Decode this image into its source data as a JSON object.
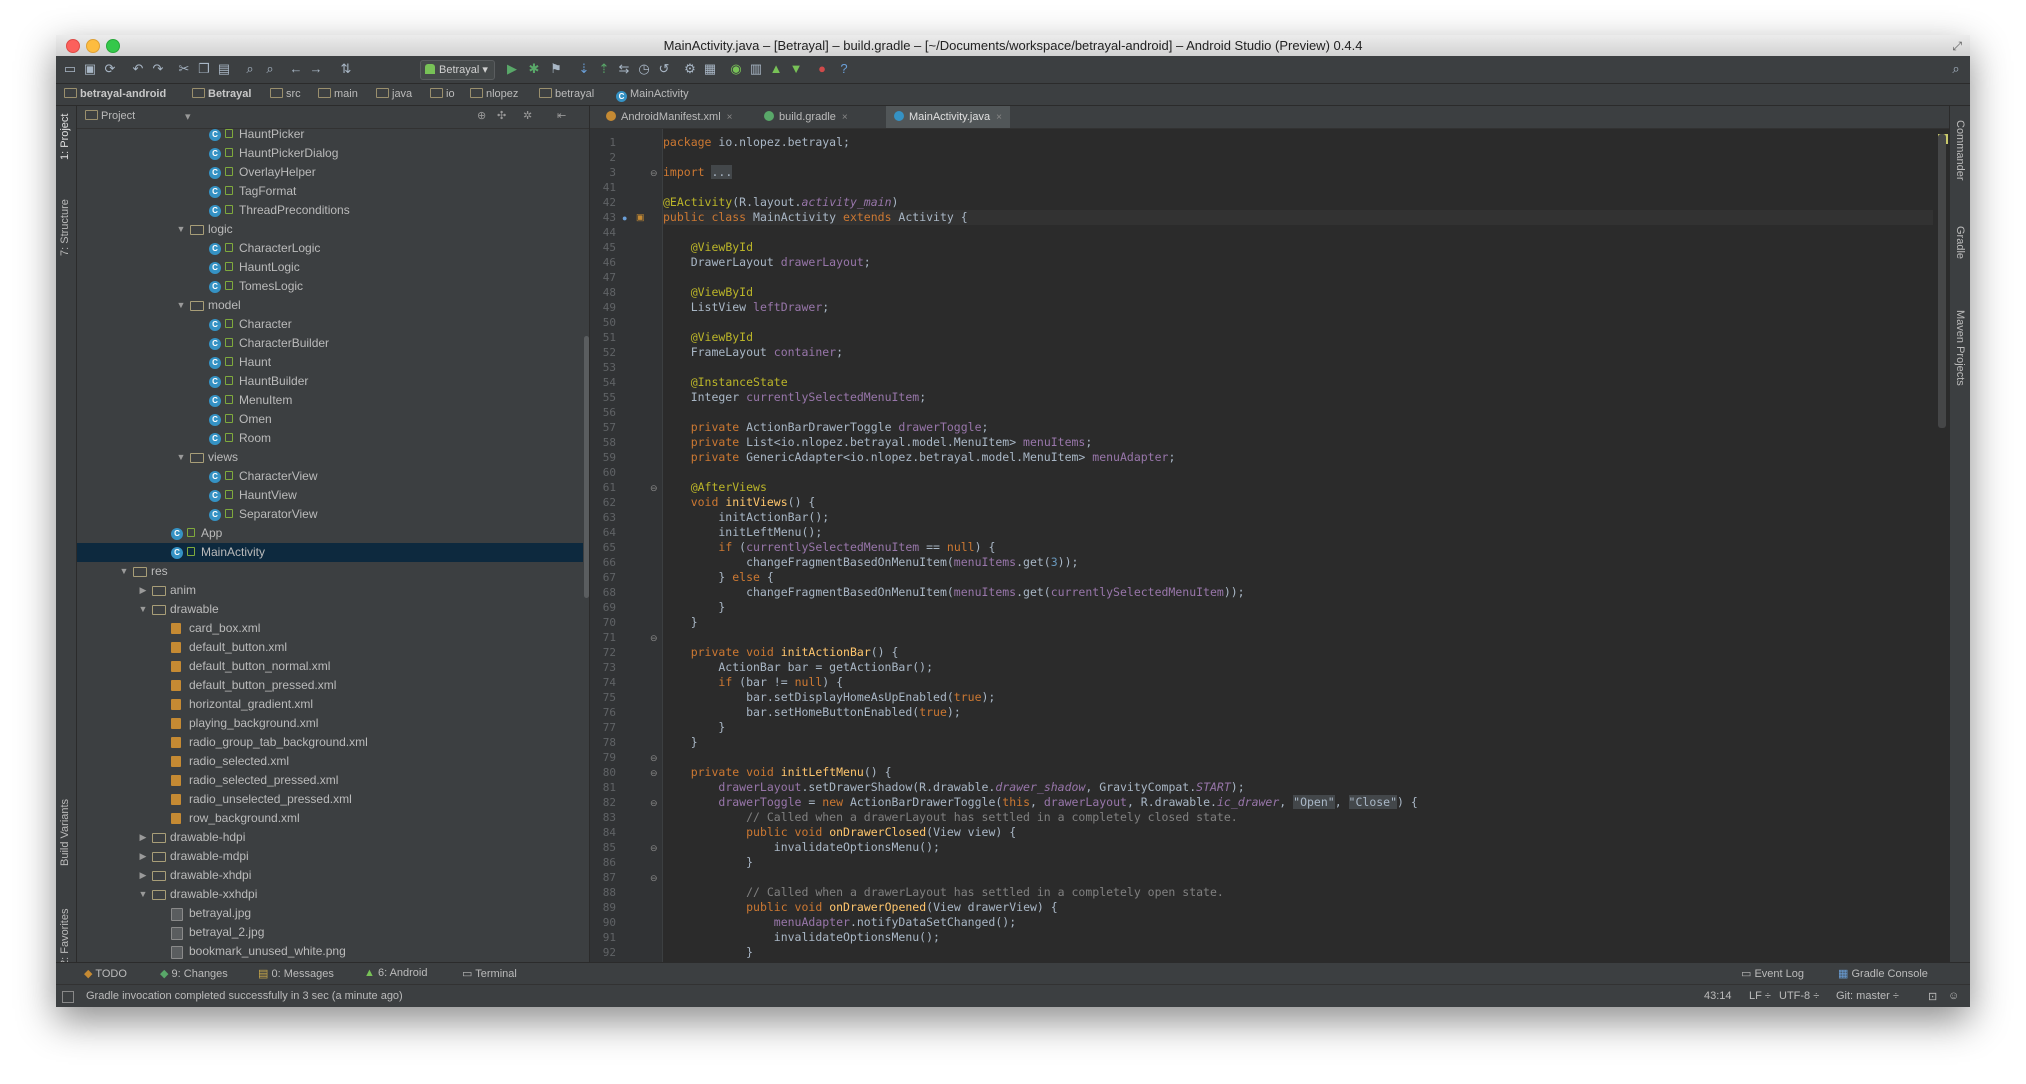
{
  "window": {
    "title": "MainActivity.java – [Betrayal] – build.gradle – [~/Documents/workspace/betrayal-android] – Android Studio (Preview) 0.4.4"
  },
  "toolbar": {
    "run_config": "Betrayal"
  },
  "breadcrumbs": [
    "betrayal-android",
    "Betrayal",
    "src",
    "main",
    "java",
    "io",
    "nlopez",
    "betrayal",
    "MainActivity"
  ],
  "left_strip": {
    "project": "1: Project",
    "structure": "7: Structure",
    "build_variants": "Build Variants",
    "favorites": "2: Favorites"
  },
  "right_strip": {
    "commander": "Commander",
    "gradle": "Gradle",
    "maven": "Maven Projects"
  },
  "project_panel": {
    "view_mode": "Project",
    "rows": [
      {
        "label": "HauntPicker",
        "type": "class"
      },
      {
        "label": "HauntPickerDialog",
        "type": "class"
      },
      {
        "label": "OverlayHelper",
        "type": "class"
      },
      {
        "label": "TagFormat",
        "type": "class"
      },
      {
        "label": "ThreadPreconditions",
        "type": "class"
      },
      {
        "label": "logic",
        "type": "folder-open"
      },
      {
        "label": "CharacterLogic",
        "type": "class"
      },
      {
        "label": "HauntLogic",
        "type": "class"
      },
      {
        "label": "TomesLogic",
        "type": "class"
      },
      {
        "label": "model",
        "type": "folder-open"
      },
      {
        "label": "Character",
        "type": "class"
      },
      {
        "label": "CharacterBuilder",
        "type": "class"
      },
      {
        "label": "Haunt",
        "type": "class"
      },
      {
        "label": "HauntBuilder",
        "type": "class"
      },
      {
        "label": "MenuItem",
        "type": "class"
      },
      {
        "label": "Omen",
        "type": "class"
      },
      {
        "label": "Room",
        "type": "class"
      },
      {
        "label": "views",
        "type": "folder-open"
      },
      {
        "label": "CharacterView",
        "type": "class"
      },
      {
        "label": "HauntView",
        "type": "class"
      },
      {
        "label": "SeparatorView",
        "type": "class"
      },
      {
        "label": "App",
        "type": "class"
      },
      {
        "label": "MainActivity",
        "type": "class"
      },
      {
        "label": "res",
        "type": "folder-open"
      },
      {
        "label": "anim",
        "type": "folder-closed"
      },
      {
        "label": "drawable",
        "type": "folder-open"
      },
      {
        "label": "card_box.xml",
        "type": "xml"
      },
      {
        "label": "default_button.xml",
        "type": "xml"
      },
      {
        "label": "default_button_normal.xml",
        "type": "xml"
      },
      {
        "label": "default_button_pressed.xml",
        "type": "xml"
      },
      {
        "label": "horizontal_gradient.xml",
        "type": "xml"
      },
      {
        "label": "playing_background.xml",
        "type": "xml"
      },
      {
        "label": "radio_group_tab_background.xml",
        "type": "xml"
      },
      {
        "label": "radio_selected.xml",
        "type": "xml"
      },
      {
        "label": "radio_selected_pressed.xml",
        "type": "xml"
      },
      {
        "label": "radio_unselected_pressed.xml",
        "type": "xml"
      },
      {
        "label": "row_background.xml",
        "type": "xml"
      },
      {
        "label": "drawable-hdpi",
        "type": "folder-closed"
      },
      {
        "label": "drawable-mdpi",
        "type": "folder-closed"
      },
      {
        "label": "drawable-xhdpi",
        "type": "folder-closed"
      },
      {
        "label": "drawable-xxhdpi",
        "type": "folder-open"
      },
      {
        "label": "betrayal.jpg",
        "type": "image"
      },
      {
        "label": "betrayal_2.jpg",
        "type": "image"
      },
      {
        "label": "bookmark_unused_white.png",
        "type": "image"
      }
    ]
  },
  "editor_tabs": [
    {
      "label": "AndroidManifest.xml",
      "active": false
    },
    {
      "label": "build.gradle",
      "active": false
    },
    {
      "label": "MainActivity.java",
      "active": true
    }
  ],
  "code_lines": [
    {
      "n": "1",
      "html": "<span class=\"kw\">package</span> io.nlopez.betrayal;"
    },
    {
      "n": "2",
      "html": ""
    },
    {
      "n": "3",
      "html": "<span class=\"kw\">import</span> <span class=\"ch\">...</span>"
    },
    {
      "n": "41",
      "html": ""
    },
    {
      "n": "42",
      "html": "<span class=\"an\">@EActivity</span>(R.layout.<span class=\"it\">activity_main</span>)"
    },
    {
      "n": "43",
      "html": "<span class=\"kw\">public class</span> MainActivity <span class=\"kw\">extends</span> Activity {",
      "current": true
    },
    {
      "n": "44",
      "html": ""
    },
    {
      "n": "45",
      "html": "    <span class=\"an\">@ViewById</span>"
    },
    {
      "n": "46",
      "html": "    DrawerLayout <span class=\"fd\">drawerLayout</span>;"
    },
    {
      "n": "47",
      "html": ""
    },
    {
      "n": "48",
      "html": "    <span class=\"an\">@ViewById</span>"
    },
    {
      "n": "49",
      "html": "    ListView <span class=\"fd\">leftDrawer</span>;"
    },
    {
      "n": "50",
      "html": ""
    },
    {
      "n": "51",
      "html": "    <span class=\"an\">@ViewById</span>"
    },
    {
      "n": "52",
      "html": "    FrameLayout <span class=\"fd\">container</span>;"
    },
    {
      "n": "53",
      "html": ""
    },
    {
      "n": "54",
      "html": "    <span class=\"an\">@InstanceState</span>"
    },
    {
      "n": "55",
      "html": "    Integer <span class=\"fd\">currentlySelectedMenuItem</span>;"
    },
    {
      "n": "56",
      "html": ""
    },
    {
      "n": "57",
      "html": "    <span class=\"kw\">private</span> ActionBarDrawerToggle <span class=\"fd\">drawerToggle</span>;"
    },
    {
      "n": "58",
      "html": "    <span class=\"kw\">private</span> List&lt;io.nlopez.betrayal.model.MenuItem&gt; <span class=\"fd\">menuItems</span>;"
    },
    {
      "n": "59",
      "html": "    <span class=\"kw\">private</span> GenericAdapter&lt;io.nlopez.betrayal.model.MenuItem&gt; <span class=\"fd\">menuAdapter</span>;"
    },
    {
      "n": "60",
      "html": ""
    },
    {
      "n": "61",
      "html": "    <span class=\"an\">@AfterViews</span>"
    },
    {
      "n": "62",
      "html": "    <span class=\"kw\">void</span> <span class=\"fn\">initViews</span>() {"
    },
    {
      "n": "63",
      "html": "        initActionBar();"
    },
    {
      "n": "64",
      "html": "        initLeftMenu();"
    },
    {
      "n": "65",
      "html": "        <span class=\"kw\">if</span> (<span class=\"fd\">currentlySelectedMenuItem</span> == <span class=\"kw\">null</span>) {"
    },
    {
      "n": "66",
      "html": "            changeFragmentBasedOnMenuItem(<span class=\"fd\">menuItems</span>.get(<span class=\"nm\">3</span>));"
    },
    {
      "n": "67",
      "html": "        } <span class=\"kw\">else</span> {"
    },
    {
      "n": "68",
      "html": "            changeFragmentBasedOnMenuItem(<span class=\"fd\">menuItems</span>.get(<span class=\"fd\">currentlySelectedMenuItem</span>));"
    },
    {
      "n": "69",
      "html": "        }"
    },
    {
      "n": "70",
      "html": "    }"
    },
    {
      "n": "71",
      "html": ""
    },
    {
      "n": "72",
      "html": "    <span class=\"kw\">private void</span> <span class=\"fn\">initActionBar</span>() {"
    },
    {
      "n": "73",
      "html": "        ActionBar bar = getActionBar();"
    },
    {
      "n": "74",
      "html": "        <span class=\"kw\">if</span> (bar != <span class=\"kw\">null</span>) {"
    },
    {
      "n": "75",
      "html": "            bar.setDisplayHomeAsUpEnabled(<span class=\"kw\">true</span>);"
    },
    {
      "n": "76",
      "html": "            bar.setHomeButtonEnabled(<span class=\"kw\">true</span>);"
    },
    {
      "n": "77",
      "html": "        }"
    },
    {
      "n": "78",
      "html": "    }"
    },
    {
      "n": "79",
      "html": ""
    },
    {
      "n": "80",
      "html": "    <span class=\"kw\">private void</span> <span class=\"fn\">initLeftMenu</span>() {"
    },
    {
      "n": "81",
      "html": "        <span class=\"fd\">drawerLayout</span>.setDrawerShadow(R.drawable.<span class=\"it\">drawer_shadow</span>, GravityCompat.<span class=\"it\">START</span>);"
    },
    {
      "n": "82",
      "html": "        <span class=\"fd\">drawerToggle</span> = <span class=\"kw\">new</span> ActionBarDrawerToggle(<span class=\"kw\">this</span>, <span class=\"fd\">drawerLayout</span>, R.drawable.<span class=\"it\">ic_drawer</span>, <span class=\"ch\">\"Open\"</span>, <span class=\"ch\">\"Close\"</span>) {"
    },
    {
      "n": "83",
      "html": "            <span class=\"cm\">// Called when a drawerLayout has settled in a completely closed state.</span>"
    },
    {
      "n": "84",
      "html": "            <span class=\"kw\">public void</span> <span class=\"fn\">onDrawerClosed</span>(View view) {"
    },
    {
      "n": "85",
      "html": "                invalidateOptionsMenu();"
    },
    {
      "n": "86",
      "html": "            }"
    },
    {
      "n": "87",
      "html": ""
    },
    {
      "n": "88",
      "html": "            <span class=\"cm\">// Called when a drawerLayout has settled in a completely open state.</span>"
    },
    {
      "n": "89",
      "html": "            <span class=\"kw\">public void</span> <span class=\"fn\">onDrawerOpened</span>(View drawerView) {"
    },
    {
      "n": "90",
      "html": "                <span class=\"fd\">menuAdapter</span>.notifyDataSetChanged();"
    },
    {
      "n": "91",
      "html": "                invalidateOptionsMenu();"
    },
    {
      "n": "92",
      "html": "            }"
    }
  ],
  "bottom_tabs": {
    "todo": "TODO",
    "changes": "9: Changes",
    "messages": "0: Messages",
    "android": "6: Android",
    "terminal": "Terminal",
    "event_log": "Event Log",
    "gradle_console": "Gradle Console"
  },
  "status": {
    "message": "Gradle invocation completed successfully in 3 sec (a minute ago)",
    "position": "43:14",
    "line_sep": "LF ÷",
    "encoding": "UTF-8 ÷",
    "vcs": "Git: master ÷"
  }
}
